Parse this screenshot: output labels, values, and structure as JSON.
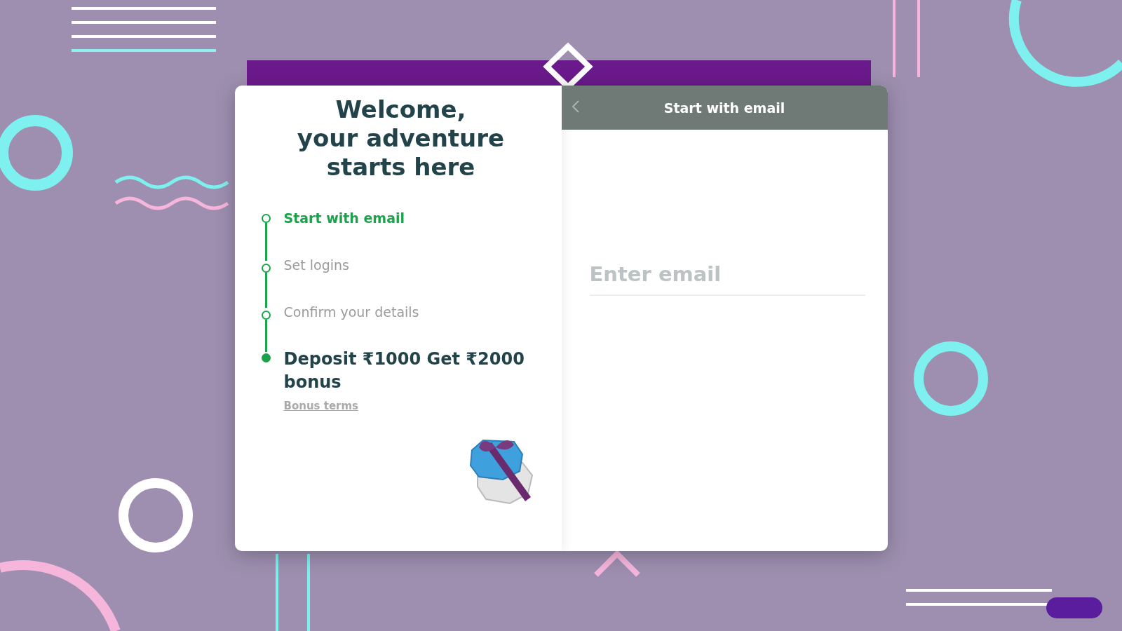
{
  "welcome": {
    "title_lines": [
      "Welcome,",
      "your adventure",
      "starts here"
    ]
  },
  "steps": [
    {
      "kind": "step",
      "label": "Start with email",
      "active": true
    },
    {
      "kind": "step",
      "label": "Set logins",
      "active": false
    },
    {
      "kind": "step",
      "label": "Confirm your details",
      "active": false
    },
    {
      "kind": "bonus",
      "label": "Deposit ₹1000 Get ₹2000 bonus",
      "link": "Bonus terms"
    }
  ],
  "panel": {
    "title": "Start with email",
    "email": {
      "placeholder": "Enter email"
    }
  }
}
